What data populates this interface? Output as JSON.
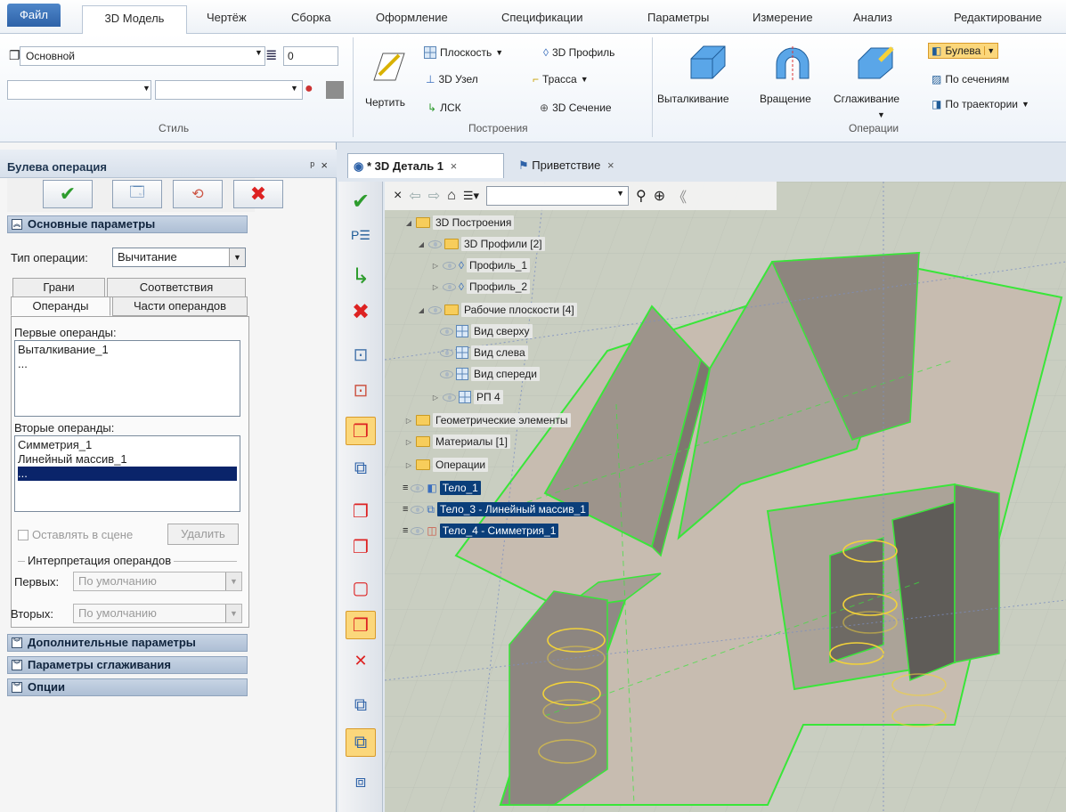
{
  "ribbon": {
    "tabs": [
      "Файл",
      "3D Модель",
      "Чертёж",
      "Сборка",
      "Оформление",
      "Спецификации",
      "Параметры",
      "Измерение",
      "Анализ",
      "Редактирование"
    ],
    "style_group": {
      "label": "Стиль",
      "layer_value": "Основной",
      "spin_value": "0"
    },
    "build_group": {
      "label": "Построения",
      "draw": "Чертить",
      "plane": "Плоскость",
      "profile3d": "3D Профиль",
      "node3d": "3D Узел",
      "path": "Трасса",
      "lsk": "ЛСК",
      "section3d": "3D Сечение"
    },
    "ops_group": {
      "label": "Операции",
      "extrude": "Выталкивание",
      "rotate": "Вращение",
      "smooth": "Сглаживание",
      "boolean": "Булева",
      "sections": "По сечениям",
      "trajectory": "По траектории"
    }
  },
  "panel": {
    "title": "Булева операция",
    "pin": "ᵖ ×",
    "main_params": "Основные параметры",
    "op_type_label": "Тип операции:",
    "op_type_value": "Вычитание",
    "tabs_row1": [
      "Грани",
      "Соответствия"
    ],
    "tabs_row2": [
      "Операнды",
      "Части операндов"
    ],
    "first_label": "Первые операнды:",
    "first_items": [
      "Выталкивание_1",
      "..."
    ],
    "second_label": "Вторые операнды:",
    "second_items": [
      "Симметрия_1",
      "Линейный массив_1",
      "..."
    ],
    "keep_label": "Оставлять в сцене",
    "delete_label": "Удалить",
    "interp_label": "Интерпретация операндов",
    "first_interp_label": "Первых:",
    "second_interp_label": "Вторых:",
    "default_value": "По умолчанию",
    "extra_params": "Дополнительные параметры",
    "smooth_params": "Параметры сглаживания",
    "options": "Опции"
  },
  "doc_tabs": {
    "active": "* 3D Деталь 1",
    "welcome": "Приветствие"
  },
  "tree": [
    {
      "label": "3D Построения"
    },
    {
      "label": "3D Профили [2]"
    },
    {
      "label": "Профиль_1"
    },
    {
      "label": "Профиль_2"
    },
    {
      "label": "Рабочие плоскости [4]"
    },
    {
      "label": "Вид сверху"
    },
    {
      "label": "Вид слева"
    },
    {
      "label": "Вид спереди"
    },
    {
      "label": "РП 4"
    },
    {
      "label": "Геометрические элементы"
    },
    {
      "label": "Материалы [1]"
    },
    {
      "label": "Операции"
    },
    {
      "label": "Тело_1"
    },
    {
      "label": "Тело_3 - Линейный массив_1"
    },
    {
      "label": "Тело_4 - Симметрия_1"
    }
  ],
  "colors": {
    "accent": "#2e62a8",
    "selection": "#0a3e7a",
    "edge_green": "#39e639",
    "hole_yellow": "#f2d23a"
  }
}
